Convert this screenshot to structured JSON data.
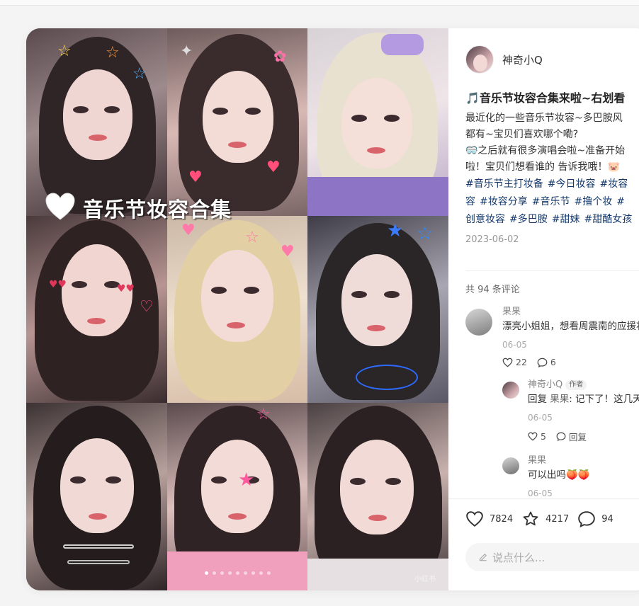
{
  "post": {
    "banner_text": "音乐节妆容合集",
    "watermark": "小红书",
    "slides_count": 9,
    "active_slide": 1
  },
  "author": {
    "name": "神奇小Q"
  },
  "content": {
    "title": "🎵音乐节妆容合集来啦~右划看",
    "body_lines": [
      "最近化的一些音乐节妆容~多巴胺风",
      "都有~宝贝们喜欢哪个嘞?",
      "🥽之后就有很多演唱会啦~准备开始",
      "啦！宝贝们想看谁的 告诉我哦！🐷"
    ],
    "tag_lines": [
      [
        "#音乐节主打妆备",
        "#今日妆容",
        "#妆容"
      ],
      [
        "容",
        "#妆容分享",
        "#音乐节",
        "#撸个妆",
        "#"
      ],
      [
        "创意妆容",
        "#多巴胺",
        "#甜妹",
        "#甜酷女孩"
      ]
    ],
    "date": "2023-06-02"
  },
  "comments_count_text": "共 94 条评论",
  "comments": [
    {
      "name": "果果",
      "text": "漂亮小姐姐，想看周震南的应援妆",
      "date": "06-05",
      "likes": "22",
      "replies": "6",
      "reply": {
        "name": "神奇小Q",
        "badge": "作者",
        "prefix": "回复 ",
        "mention": "果果",
        "text": ": 记下了！这几天",
        "date": "06-05",
        "likes": "5",
        "reply_label": "回复"
      }
    },
    {
      "name": "果果",
      "text": "可以出吗🍑🍑",
      "date": "06-05"
    }
  ],
  "stats": {
    "likes": "7824",
    "collects": "4217",
    "comments": "94"
  },
  "input": {
    "placeholder": "说点什么..."
  },
  "colors": {
    "tag": "#13386c",
    "accent": "#ff2442"
  }
}
